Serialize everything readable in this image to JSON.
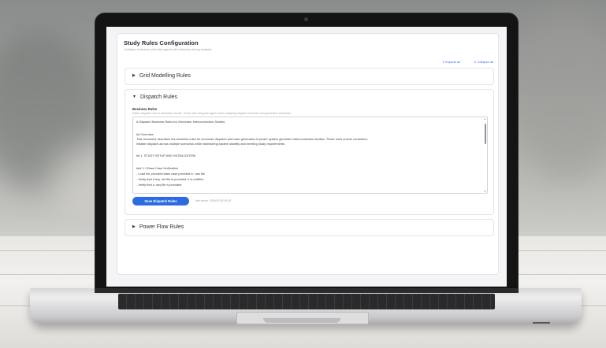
{
  "app": {
    "title": "Study Rules Configuration",
    "subtitle": "Configure business rules that agents will reference during analysis",
    "expand_all": "∨ Expand all",
    "collapse_all": "∧ Collapse all"
  },
  "sections": [
    {
      "title": "Grid Modelling Rules",
      "expanded": false
    },
    {
      "title": "Dispatch Rules",
      "expanded": true
    },
    {
      "title": "Power Flow Rules",
      "expanded": false
    }
  ],
  "dispatch": {
    "label": "Business Rules",
    "hint": "Define dispatch rules in Markdown format. These rules will guide agents when analyzing dispatch scenarios and generation schedules.",
    "lines": [
      "# Dispatch Business Rules for Generator Interconnection Studies",
      "",
      "## Overview",
      "This document describes the business rules for economic dispatch and case generation in power system generator interconnection studies. These rules ensure consistent,",
      "reliable dispatch across multiple scenarios while maintaining system stability and meeting study requirements.",
      "",
      "## 1. STUDY SETUP AND INITIALIZATION",
      "",
      "### 1.1 Base Case Verification",
      "- Load the provided base case provided in .raw file",
      "- Verify that if any .idv file is provided, it is notified.",
      "- Verify that a .seq file is provided."
    ],
    "save_label": "Save Dispatch Rules",
    "last_saved": "Last saved: 2026/07/18 05:25"
  },
  "colors": {
    "accent": "#2d6be0",
    "link": "#3a6fd8",
    "text": "#2b2f3a"
  }
}
